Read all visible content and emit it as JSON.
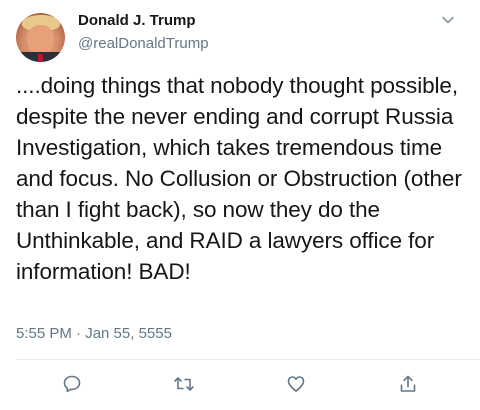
{
  "user": {
    "name": "Donald J. Trump",
    "handle": "@realDonaldTrump"
  },
  "tweet": {
    "text": "....doing things that nobody thought possible, despite the never ending and corrupt Russia Investigation, which takes tremendous time and focus. No Collusion or Obstruction (other than I fight back), so now they do the Unthinkable, and RAID a lawyers office for information! BAD!",
    "timestamp": "5:55 PM · Jan 55, 5555"
  },
  "actions": {
    "icons": [
      "reply-icon",
      "retweet-icon",
      "like-icon",
      "share-icon"
    ]
  },
  "colors": {
    "text": "#14171a",
    "secondary": "#657786",
    "divider": "#e6ecf0",
    "icon": "#657786"
  }
}
